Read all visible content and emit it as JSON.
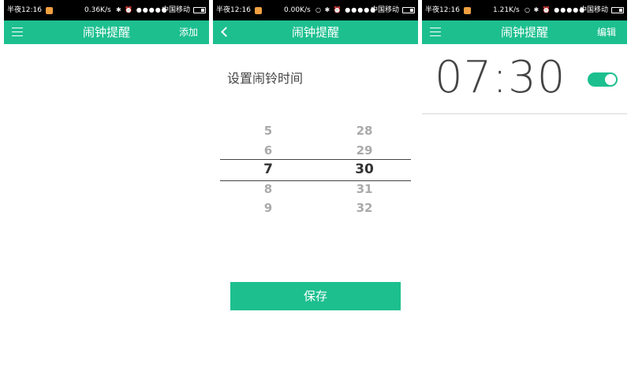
{
  "colors": {
    "accent": "#1dbf8f",
    "statusbar": "#000000"
  },
  "statusbars": [
    {
      "time": "半夜12:16",
      "net": "0.36K/s",
      "icons": "✱ ⏰ ●●●●● ",
      "carrier": "中国移动"
    },
    {
      "time": "半夜12:16",
      "net": "0.00K/s",
      "icons": "○ ✱ ⏰ ●●●●● ",
      "carrier": "中国移动"
    },
    {
      "time": "半夜12:16",
      "net": "1.21K/s",
      "icons": "○ ✱ ⏰ ●●●●● ",
      "carrier": "中国移动"
    }
  ],
  "screen1": {
    "title": "闹钟提醒",
    "action": "添加",
    "left_icon": "menu-icon"
  },
  "screen2": {
    "title": "闹钟提醒",
    "left_icon": "back-icon",
    "prompt": "设置闹铃时间",
    "hours": [
      "5",
      "6",
      "7",
      "8",
      "9"
    ],
    "minutes": [
      "28",
      "29",
      "30",
      "31",
      "32"
    ],
    "selected_hour": "7",
    "selected_minute": "30",
    "save_label": "保存"
  },
  "screen3": {
    "title": "闹钟提醒",
    "action": "编辑",
    "left_icon": "menu-icon",
    "alarm_time": "07:30",
    "alarm_enabled": true
  }
}
